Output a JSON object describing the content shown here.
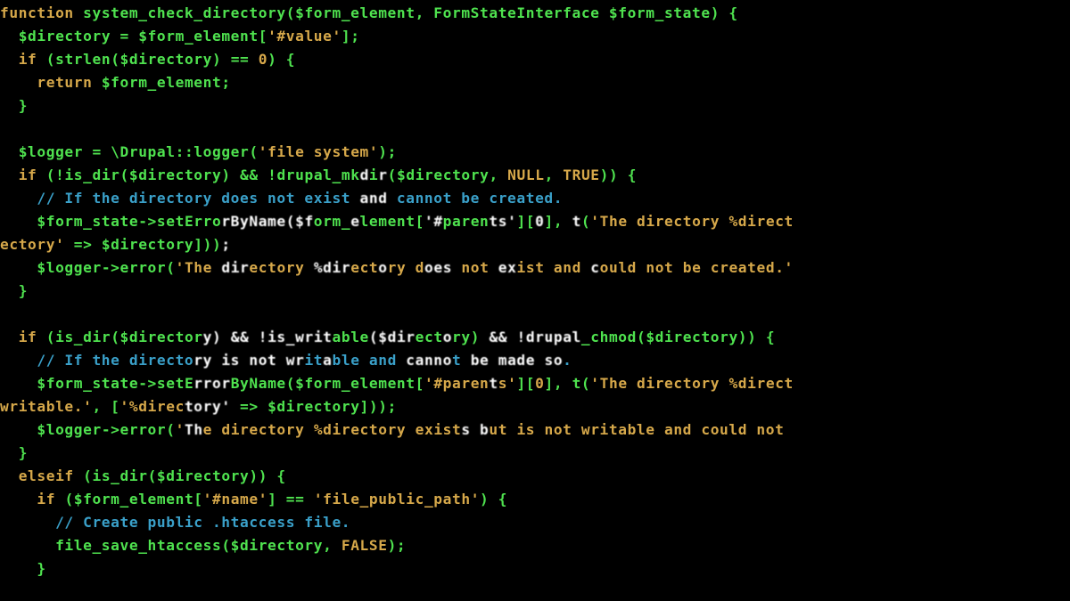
{
  "code": {
    "l1": {
      "kw_function": "function",
      "fn_name": "system_check_directory",
      "p1": "(",
      "v_fe": "$form_element",
      "comma": ", ",
      "type": "FormStateInterface",
      "sp": " ",
      "v_fs": "$form_state",
      "p2": ") {"
    },
    "l2": {
      "ind": "  ",
      "v_dir": "$directory",
      "eq": " = ",
      "v_fe": "$form_element",
      "idx": "[",
      "str": "'#value'",
      "idxe": "];"
    },
    "l3": {
      "ind": "  ",
      "kw_if": "if",
      "p": " (",
      "fn": "strlen",
      "p2": "(",
      "v": "$directory",
      "p3": ") == ",
      "num": "0",
      "p4": ") {"
    },
    "l4": {
      "ind": "    ",
      "kw": "return",
      "sp": " ",
      "v": "$form_element",
      "semi": ";"
    },
    "l5": {
      "ind": "  ",
      "brace": "}"
    },
    "l6": {
      "blank": ""
    },
    "l7": {
      "ind": "  ",
      "v": "$logger",
      "eq": " = ",
      "ns": "\\Drupal",
      "op": "::",
      "fn": "logger",
      "p": "(",
      "str": "'file system'",
      "p2": ");"
    },
    "l8": {
      "ind": "  ",
      "kw": "if",
      "p": " (!",
      "fn": "is_dir",
      "p2": "(",
      "v": "$directory",
      "p3": ") && !",
      "fn2": "drupal_mk",
      "b1": "d",
      "b1b": "i",
      "b1c": "r",
      "b2": "(",
      "v2": "$directory",
      "comma": ", ",
      "c1": "NULL",
      "comma2": ", ",
      "c2": "TRUE",
      "p4": ")) {"
    },
    "l9": {
      "ind": "    ",
      "cmt_a": "// If the directory does not exist ",
      "b": "and",
      "cmt_b": " cannot be created."
    },
    "l10": {
      "ind": "    ",
      "v": "$form_state",
      "arrow": "->",
      "fn": "setErro",
      "b": "rByName($f",
      "fn2": "orm_",
      "b2": "e",
      "fn3": "lement[",
      "b3": "'#",
      "fn4": "paren",
      "b4": "ts'",
      "fn5": "][",
      "b5": "0",
      "fn6": "], ",
      "b6": "t",
      "fn7": "(",
      "str": "'The directory %direct"
    },
    "l10b": {
      "a": "ectory'",
      "b": " => ",
      "c": "$directory",
      "d": "]))",
      "e": ";"
    },
    "l11": {
      "ind": "    ",
      "v": "$logger",
      "arrow": "->",
      "fn": "error",
      "p": "(",
      "str_a": "'The",
      "sp": " ",
      "b1": "dir",
      "str_b": "ectory ",
      "b2": "%dir",
      "str_c": "ect",
      "b2b": "o",
      "str_c2": "ry d",
      "b3": "oes",
      "str_d": " not ",
      "b4": "ex",
      "str_e": "ist and ",
      "b5": "c",
      "str_f": "ould not be created.'"
    },
    "l12": {
      "ind": "  ",
      "brace": "}"
    },
    "l13": {
      "blank": ""
    },
    "l14": {
      "ind": "  ",
      "kw": "if",
      "p": " (",
      "fn": "is_dir",
      "p2": "(",
      "v": "$director",
      "b1": "y) && !is_writ",
      "a2": "able",
      "b2": "($dir",
      "a3": "ect",
      "b3": "o",
      "a4": "ry) ",
      "b4": "&& !drupal",
      "a5": "_chmod(",
      "v3": "$directory",
      "p5": ")) {"
    },
    "l15": {
      "ind": "    ",
      "cmt_a": "// If the directo",
      "b1": "ry is not wr",
      "cmt_b": "it",
      "b2": "a",
      "cmt_c": "ble and ",
      "b3": "canno",
      "cmt_d": "t ",
      "b4": "be made so",
      "cmt_e": "."
    },
    "l16": {
      "ind": "    ",
      "v": "$form_state",
      "arrow": "->",
      "fn": "setE",
      "b1": "rror",
      "fn2": "ByName(",
      "v2": "$form_element",
      "idx": "[",
      "str": "'#paren",
      "b2": "t",
      "str2": "s'",
      "idx2": "][",
      "num": "0",
      "idx3": "], ",
      "fnt": "t",
      "p3": "(",
      "str3": "'The directory %direct"
    },
    "l16b": {
      "a": "writable.'",
      "comma": ", ",
      "lb": "[",
      "str": "'%direc",
      "b": "tory'",
      "arrow": " => ",
      "v": "$directory",
      "rb": "]));"
    },
    "l17": {
      "ind": "    ",
      "v": "$logger",
      "arrow": "->",
      "fn": "error",
      "p": "(",
      "str_a": "'",
      "b1": "Th",
      "str_b": "e directory %directory exist",
      "b2": "s b",
      "str_c": "ut is not writable and could not "
    },
    "l18": {
      "ind": "  ",
      "brace": "}"
    },
    "l19": {
      "ind": "  ",
      "kw": "elseif",
      "p": " (",
      "fn": "is_dir",
      "p2": "(",
      "v": "$directory",
      "p3": ")) {"
    },
    "l20": {
      "ind": "    ",
      "kw": "if",
      "p": " (",
      "v": "$form_element",
      "idx": "[",
      "str": "'#name'",
      "idx2": "] == ",
      "str2": "'file_public_path'",
      "p2": ") {"
    },
    "l21": {
      "ind": "      ",
      "cmt": "// Create public .htaccess file."
    },
    "l22": {
      "ind": "      ",
      "fn": "file_save_htaccess",
      "p": "(",
      "v": "$directory",
      "comma": ", ",
      "c": "FALSE",
      "p2": ");"
    },
    "l23": {
      "ind": "    ",
      "brace": "}"
    }
  }
}
